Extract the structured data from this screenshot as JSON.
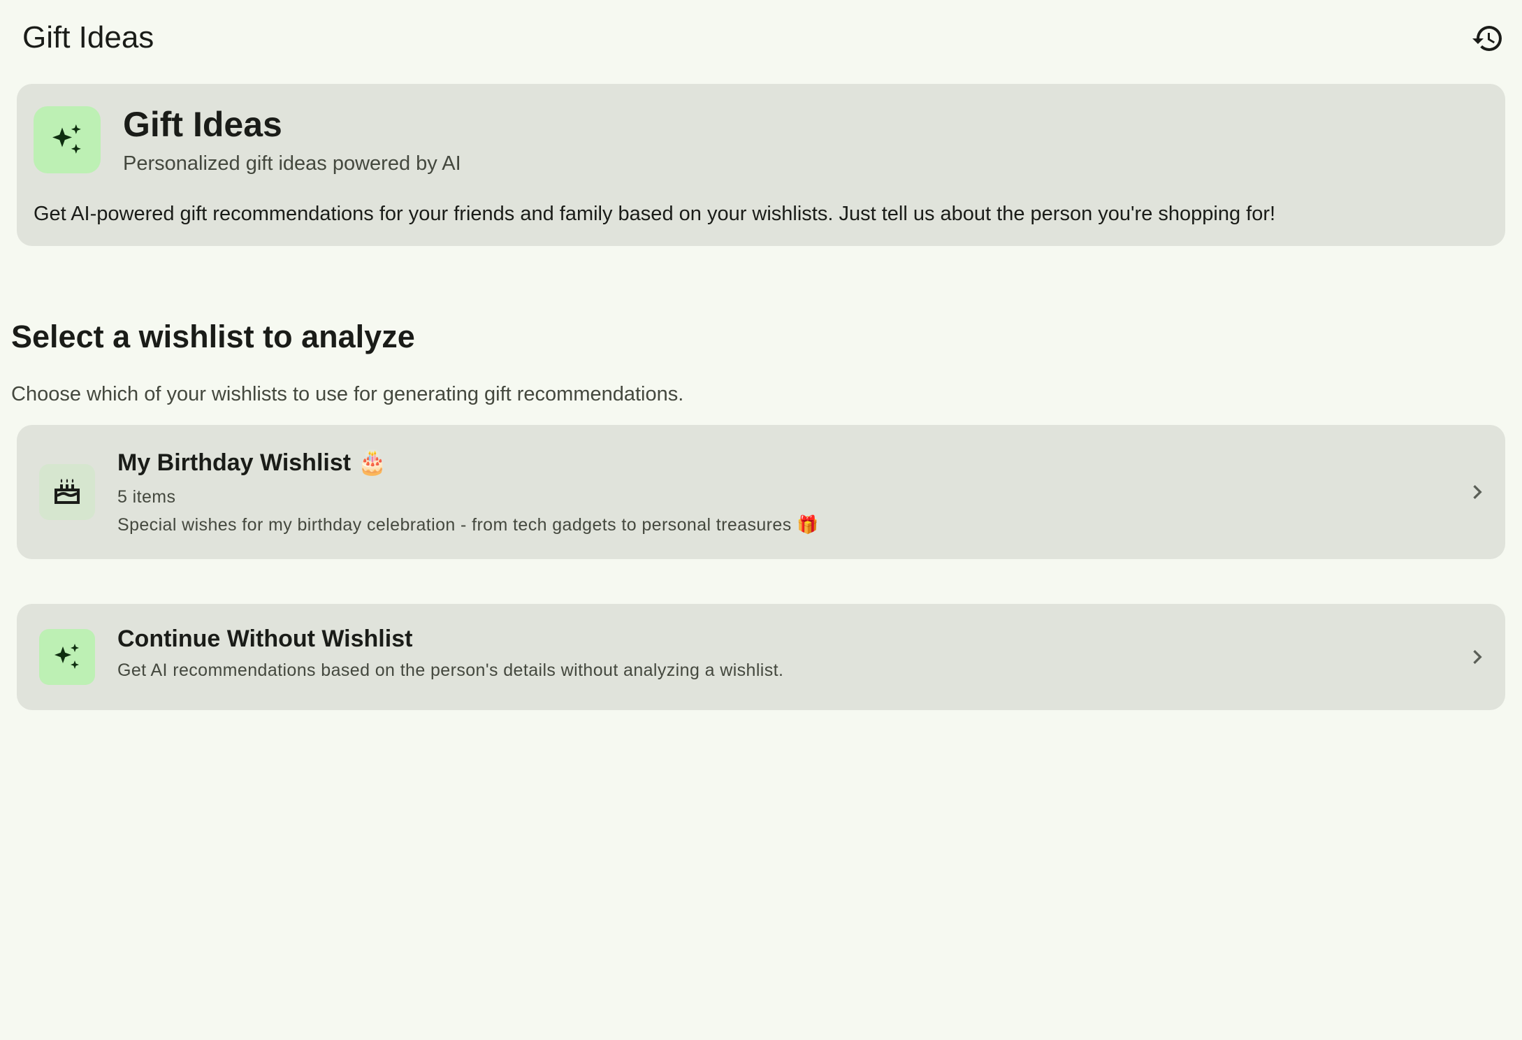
{
  "app_bar": {
    "title": "Gift Ideas",
    "history_icon": "history-icon"
  },
  "header_card": {
    "icon": "sparkles-icon",
    "title": "Gift Ideas",
    "subtitle": "Personalized gift ideas powered by AI",
    "description": "Get AI-powered gift recommendations for your friends and family based on your wishlists. Just tell us about the person you're shopping for!"
  },
  "section": {
    "title": "Select a wishlist to analyze",
    "subtitle": "Choose which of your wishlists to use for generating gift recommendations."
  },
  "wishlists": [
    {
      "icon": "cake-icon",
      "title": "My Birthday Wishlist 🎂",
      "count": "5 items",
      "description": "Special wishes for my birthday celebration - from tech gadgets to personal treasures 🎁",
      "chevron_icon": "chevron-right-icon"
    }
  ],
  "no_wishlist_option": {
    "icon": "sparkles-icon",
    "title": "Continue Without Wishlist",
    "description": "Get AI recommendations based on the person's details without analyzing a wishlist.",
    "chevron_icon": "chevron-right-icon"
  },
  "colors": {
    "background": "#f6f9f1",
    "card": "#e0e3db",
    "accent_container": "#bdf0b4",
    "text_primary": "#1a1c18",
    "text_secondary": "#44483e"
  }
}
